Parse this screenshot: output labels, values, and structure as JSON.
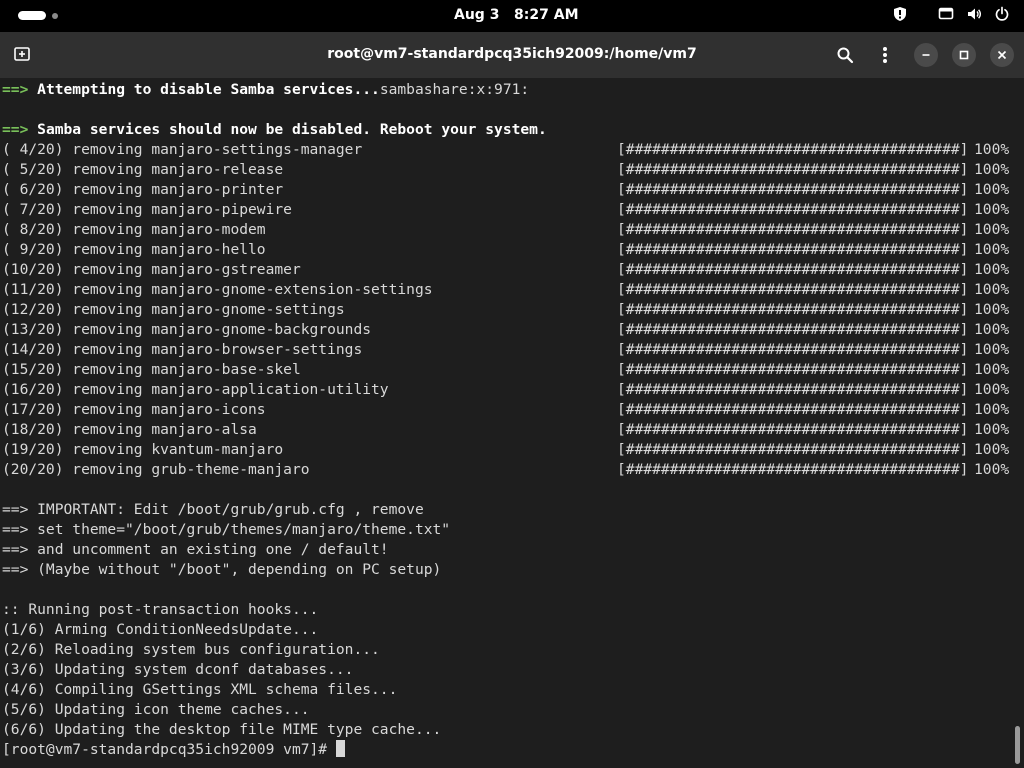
{
  "topbar": {
    "clock": "Aug 3   8:27 AM"
  },
  "window": {
    "title": "root@vm7-standardpcq35ich92009:/home/vm7"
  },
  "terminal": {
    "intro": [
      {
        "arrow": "==>",
        "bold": "Attempting to disable Samba services...",
        "rest": "sambashare:x:971:"
      },
      {
        "arrow": "==>",
        "bold": "Samba services should now be disabled. Reboot your system.",
        "rest": ""
      }
    ],
    "removals": [
      {
        "step": "( 4/20) removing manjaro-settings-manager",
        "bar": "[######################################]",
        "pct": "100%"
      },
      {
        "step": "( 5/20) removing manjaro-release",
        "bar": "[######################################]",
        "pct": "100%"
      },
      {
        "step": "( 6/20) removing manjaro-printer",
        "bar": "[######################################]",
        "pct": "100%"
      },
      {
        "step": "( 7/20) removing manjaro-pipewire",
        "bar": "[######################################]",
        "pct": "100%"
      },
      {
        "step": "( 8/20) removing manjaro-modem",
        "bar": "[######################################]",
        "pct": "100%"
      },
      {
        "step": "( 9/20) removing manjaro-hello",
        "bar": "[######################################]",
        "pct": "100%"
      },
      {
        "step": "(10/20) removing manjaro-gstreamer",
        "bar": "[######################################]",
        "pct": "100%"
      },
      {
        "step": "(11/20) removing manjaro-gnome-extension-settings",
        "bar": "[######################################]",
        "pct": "100%"
      },
      {
        "step": "(12/20) removing manjaro-gnome-settings",
        "bar": "[######################################]",
        "pct": "100%"
      },
      {
        "step": "(13/20) removing manjaro-gnome-backgrounds",
        "bar": "[######################################]",
        "pct": "100%"
      },
      {
        "step": "(14/20) removing manjaro-browser-settings",
        "bar": "[######################################]",
        "pct": "100%"
      },
      {
        "step": "(15/20) removing manjaro-base-skel",
        "bar": "[######################################]",
        "pct": "100%"
      },
      {
        "step": "(16/20) removing manjaro-application-utility",
        "bar": "[######################################]",
        "pct": "100%"
      },
      {
        "step": "(17/20) removing manjaro-icons",
        "bar": "[######################################]",
        "pct": "100%"
      },
      {
        "step": "(18/20) removing manjaro-alsa",
        "bar": "[######################################]",
        "pct": "100%"
      },
      {
        "step": "(19/20) removing kvantum-manjaro",
        "bar": "[######################################]",
        "pct": "100%"
      },
      {
        "step": "(20/20) removing grub-theme-manjaro",
        "bar": "[######################################]",
        "pct": "100%"
      }
    ],
    "notes": [
      "==> IMPORTANT: Edit /boot/grub/grub.cfg , remove",
      "==> set theme=\"/boot/grub/themes/manjaro/theme.txt\"",
      "==> and uncomment an existing one / default!",
      "==> (Maybe without \"/boot\", depending on PC setup)"
    ],
    "hooks": [
      ":: Running post-transaction hooks...",
      "(1/6) Arming ConditionNeedsUpdate...",
      "(2/6) Reloading system bus configuration...",
      "(3/6) Updating system dconf databases...",
      "(4/6) Compiling GSettings XML schema files...",
      "(5/6) Updating icon theme caches...",
      "(6/6) Updating the desktop file MIME type cache..."
    ],
    "prompt": "[root@vm7-standardpcq35ich92009 vm7]# "
  },
  "icons": {
    "new_tab": "new-tab-icon",
    "search": "search-icon",
    "menu": "kebab-menu-icon",
    "minimize": "minimize-icon",
    "maximize": "maximize-icon",
    "close": "close-icon",
    "shield": "shield-icon",
    "display": "display-icon",
    "volume": "volume-icon",
    "power": "power-icon"
  },
  "colors": {
    "arrow": "#79c05a",
    "background": "#1e1e1e",
    "titlebar": "#303030"
  }
}
